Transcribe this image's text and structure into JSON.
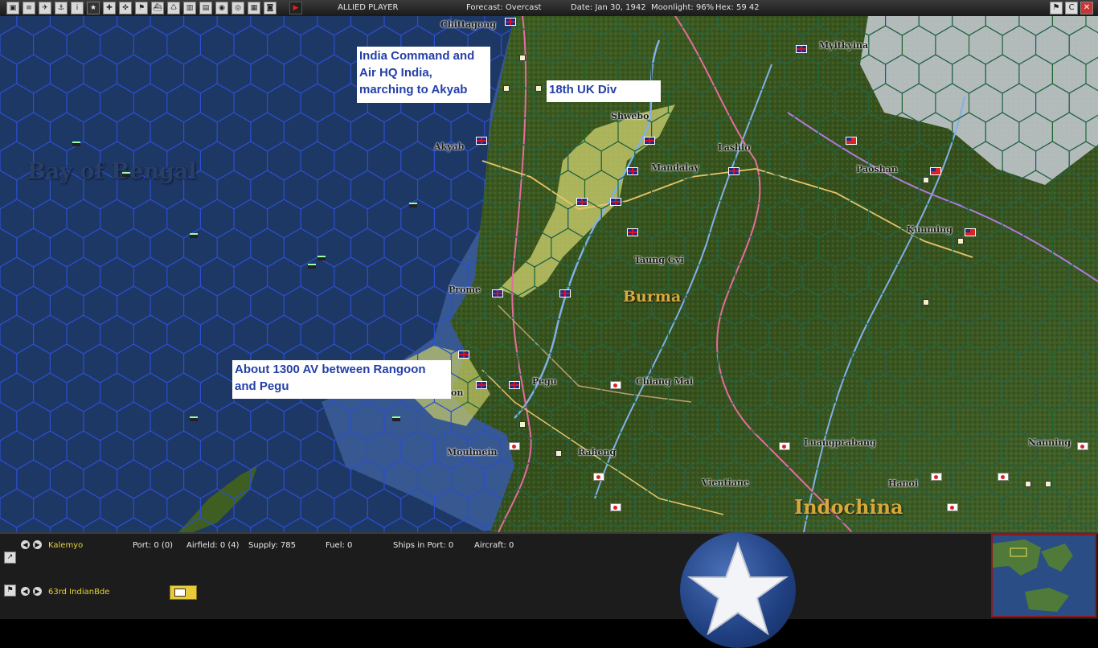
{
  "toolbar": {
    "player": "ALLIED PLAYER",
    "forecast": "Forecast: Overcast",
    "date": "Date: Jan 30, 1942",
    "moonlight": "Moonlight: 96%",
    "hex": "Hex: 59 42",
    "buttons": [
      "summary",
      "report",
      "air",
      "naval",
      "intel",
      "victory",
      "medal",
      "ground",
      "flag",
      "ships",
      "factory",
      "lcu",
      "globe",
      "options",
      "view",
      "map"
    ],
    "window_buttons": [
      "restore",
      "c",
      "close"
    ]
  },
  "map": {
    "places": {
      "chittagong": "Chittagong",
      "myitkyina": "Myitkyina",
      "shwebo": "Shwebo",
      "akyab": "Akyab",
      "lashio": "Lashio",
      "mandalay": "Mandalay",
      "paoshan": "Paoshan",
      "kunming": "Kunming",
      "taunggyi": "Taung Gyi",
      "prome": "Prome",
      "pegu": "Pegu",
      "chiangmai": "Chiang Mai",
      "moulmein": "Moulmein",
      "raheng": "Raheng",
      "luangprabang": "Luangprabang",
      "vientiane": "Vientiane",
      "hanoi": "Hanoi",
      "nanning": "Nanning",
      "rangoon_partial": "on"
    },
    "regions": {
      "bay": "Bay of Bengal",
      "burma": "Burma",
      "indochina": "Indochina"
    },
    "annotations": {
      "india_command": "India Command and Air HQ India, marching to Akyab",
      "uk_div": "18th UK Div",
      "av": "About 1300 AV between Rangoon and Pegu"
    },
    "colors": {
      "sea": "#1e3866",
      "hexline": "#2b4fd0",
      "land": "#3b5a1c",
      "annotation_text": "#2440a8"
    }
  },
  "bottom": {
    "location": "Kalemyo",
    "port": "Port: 0 (0)",
    "airfield": "Airfield: 0 (4)",
    "supply": "Supply: 785",
    "fuel": "Fuel: 0",
    "ships_in_port": "Ships in Port: 0",
    "aircraft": "Aircraft: 0",
    "unit": "63rd IndianBde"
  }
}
